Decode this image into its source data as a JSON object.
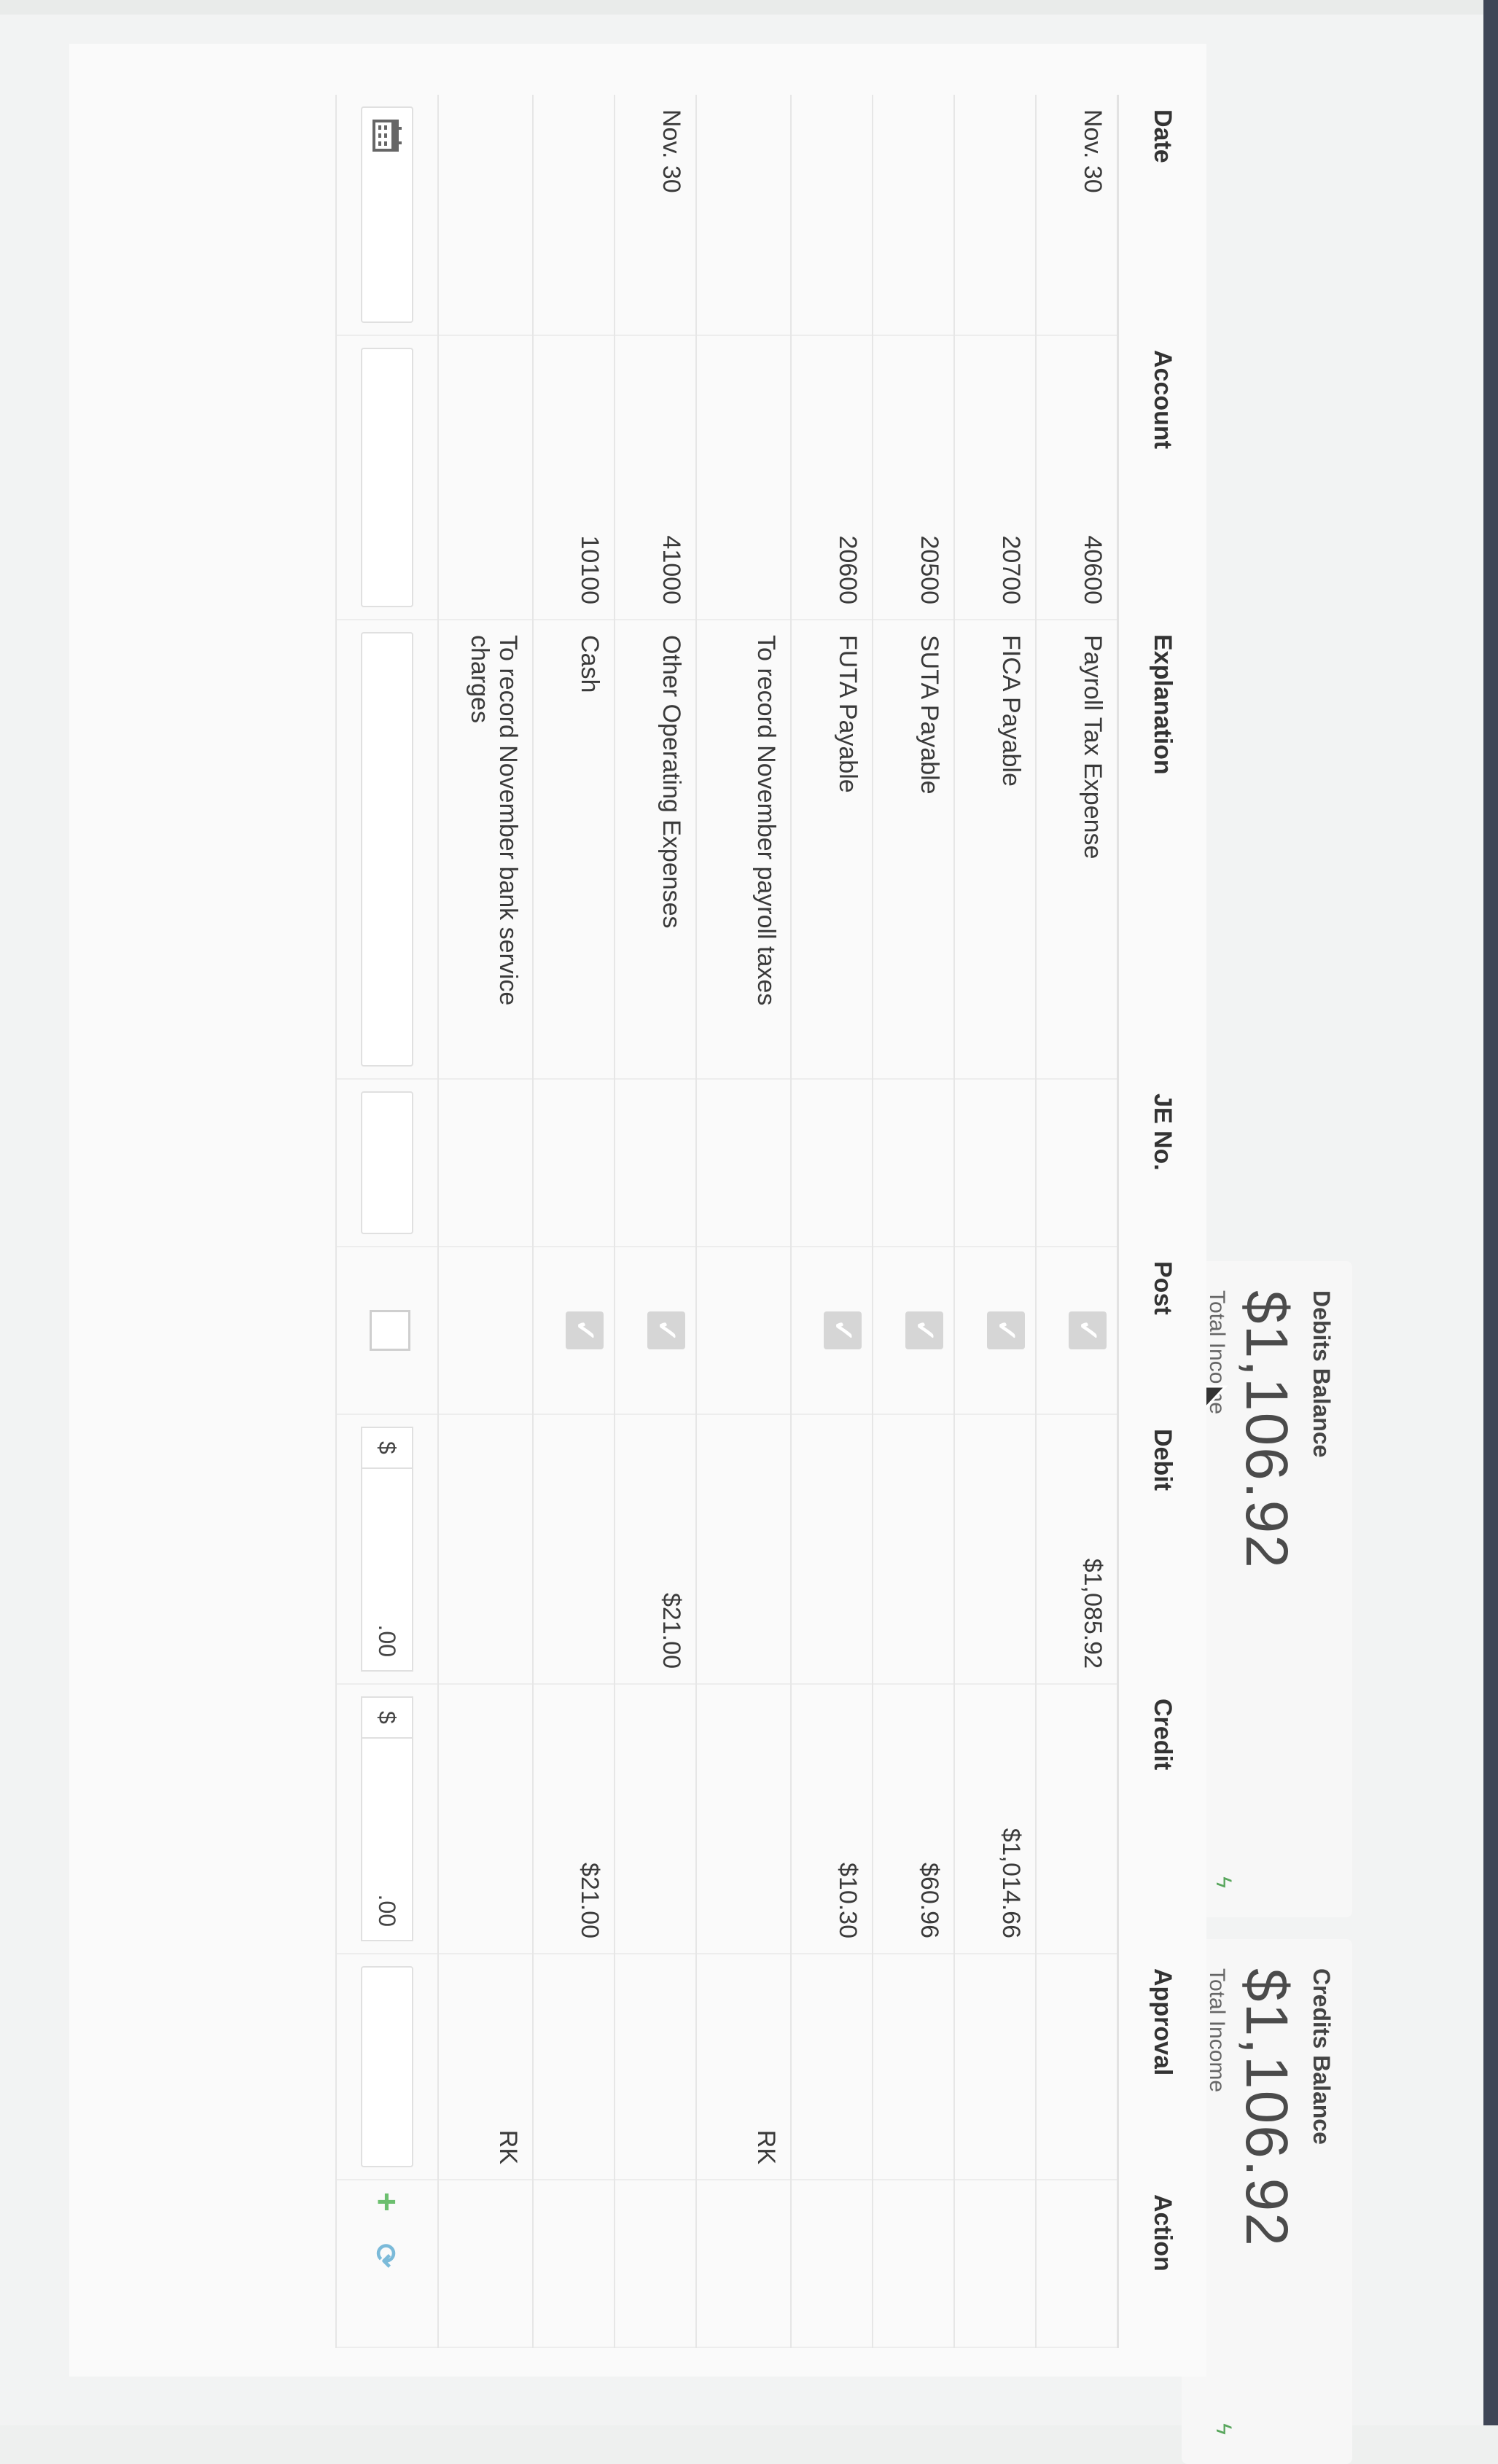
{
  "summary": {
    "debits": {
      "label": "Debits Balance",
      "amount": "$1,106.92",
      "sub": "Total Income"
    },
    "credits": {
      "label": "Credits Balance",
      "amount": "$1,106.92",
      "sub": "Total Income"
    }
  },
  "table": {
    "columns": [
      "Date",
      "Account",
      "Explanation",
      "JE No.",
      "Post",
      "Debit",
      "Credit",
      "Approval",
      "Action"
    ],
    "rows": [
      {
        "date": "Nov. 30",
        "account": "40600",
        "explanation": "Payroll Tax Expense",
        "je": "",
        "posted": true,
        "debit": "$1,085.92",
        "credit": "",
        "approval": ""
      },
      {
        "date": "",
        "account": "20700",
        "explanation": "FICA Payable",
        "je": "",
        "posted": true,
        "debit": "",
        "credit": "$1,014.66",
        "approval": ""
      },
      {
        "date": "",
        "account": "20500",
        "explanation": "SUTA Payable",
        "je": "",
        "posted": true,
        "debit": "",
        "credit": "$60.96",
        "approval": ""
      },
      {
        "date": "",
        "account": "20600",
        "explanation": "FUTA Payable",
        "je": "",
        "posted": true,
        "debit": "",
        "credit": "$10.30",
        "approval": ""
      },
      {
        "date": "",
        "account": "",
        "explanation": "To record November payroll taxes",
        "je": "",
        "posted": false,
        "debit": "",
        "credit": "",
        "approval": "RK"
      },
      {
        "date": "Nov. 30",
        "account": "41000",
        "explanation": "Other Operating Expenses",
        "je": "",
        "posted": true,
        "debit": "$21.00",
        "credit": "",
        "approval": ""
      },
      {
        "date": "",
        "account": "10100",
        "explanation": "Cash",
        "je": "",
        "posted": true,
        "debit": "",
        "credit": "$21.00",
        "approval": ""
      },
      {
        "date": "",
        "account": "",
        "explanation": "To record November bank service charges",
        "je": "",
        "posted": false,
        "debit": "",
        "credit": "",
        "approval": "RK"
      }
    ],
    "input_row": {
      "debit_currency": "$",
      "debit_value": ".00",
      "credit_currency": "$",
      "credit_value": ".00",
      "add_symbol": "+",
      "reset_symbol": "⟳"
    }
  },
  "icons": {
    "post": "check-icon",
    "date_input": "calendar-icon",
    "add": "plus-icon",
    "reset": "refresh-icon",
    "card_flash": "bolt-icon"
  },
  "colors": {
    "post_check_bg": "#d6d6d6",
    "add_green": "#6cbf6f",
    "reset_blue": "#7bbad9",
    "topbar": "#3f4656"
  }
}
